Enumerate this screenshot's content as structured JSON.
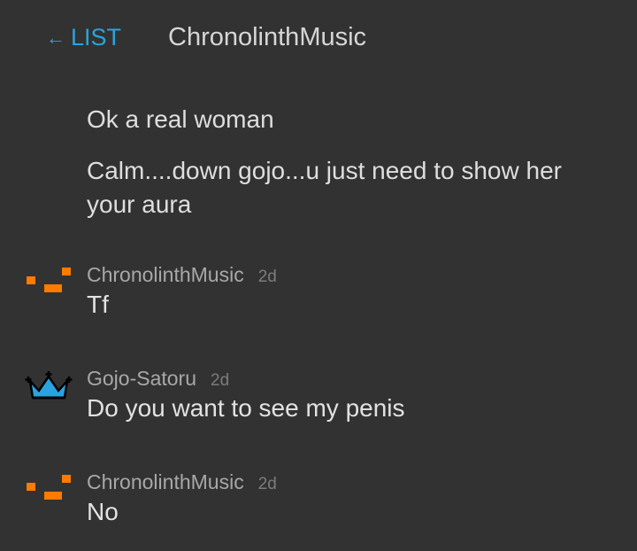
{
  "header": {
    "back_label": "LIST",
    "back_arrow": "←",
    "title": "ChronolinthMusic"
  },
  "continuation_messages": [
    {
      "text": "Ok a real woman"
    },
    {
      "text": "Calm....down gojo...u just need to show her your aura"
    }
  ],
  "messages": [
    {
      "author": "ChronolinthMusic",
      "time": "2d",
      "text": "Tf",
      "avatar": "pixel-blocks-icon"
    },
    {
      "author": "Gojo-Satoru",
      "time": "2d",
      "text": "Do you want to see my penis",
      "avatar": "crown-icon"
    },
    {
      "author": "ChronolinthMusic",
      "time": "2d",
      "text": "No",
      "avatar": "pixel-blocks-icon"
    }
  ],
  "colors": {
    "background": "#323232",
    "link": "#29a3e0",
    "orange_avatar": "#ff7b00",
    "crown_fill": "#29a3e0"
  }
}
